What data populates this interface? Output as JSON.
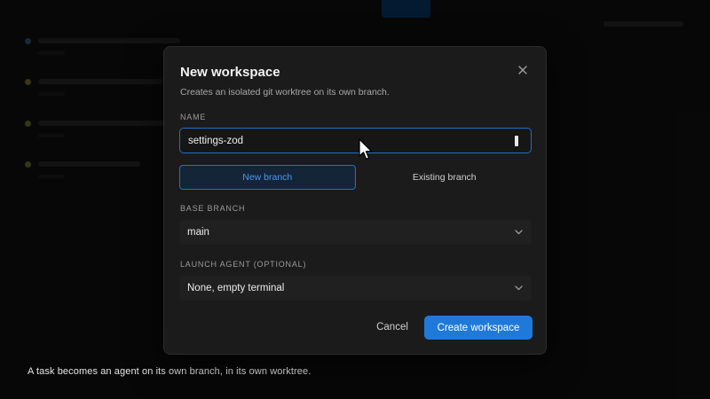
{
  "caption": "A task becomes an agent on its own branch, in its own worktree.",
  "dialog": {
    "title": "New workspace",
    "subtitle": "Creates an isolated git worktree on its own branch.",
    "close_icon": "close-icon",
    "name": {
      "label": "NAME",
      "value": "settings-zod"
    },
    "branch_mode": {
      "options": [
        "New branch",
        "Existing branch"
      ],
      "selected": "New branch"
    },
    "base_branch": {
      "label": "BASE BRANCH",
      "value": "main"
    },
    "launch_agent": {
      "label": "LAUNCH AGENT (OPTIONAL)",
      "value": "None, empty terminal"
    },
    "cancel_label": "Cancel",
    "create_label": "Create workspace"
  },
  "colors": {
    "accent": "#1f79d8",
    "dialog_bg": "#1b1b1c",
    "focus_border": "#1f6fc9"
  }
}
